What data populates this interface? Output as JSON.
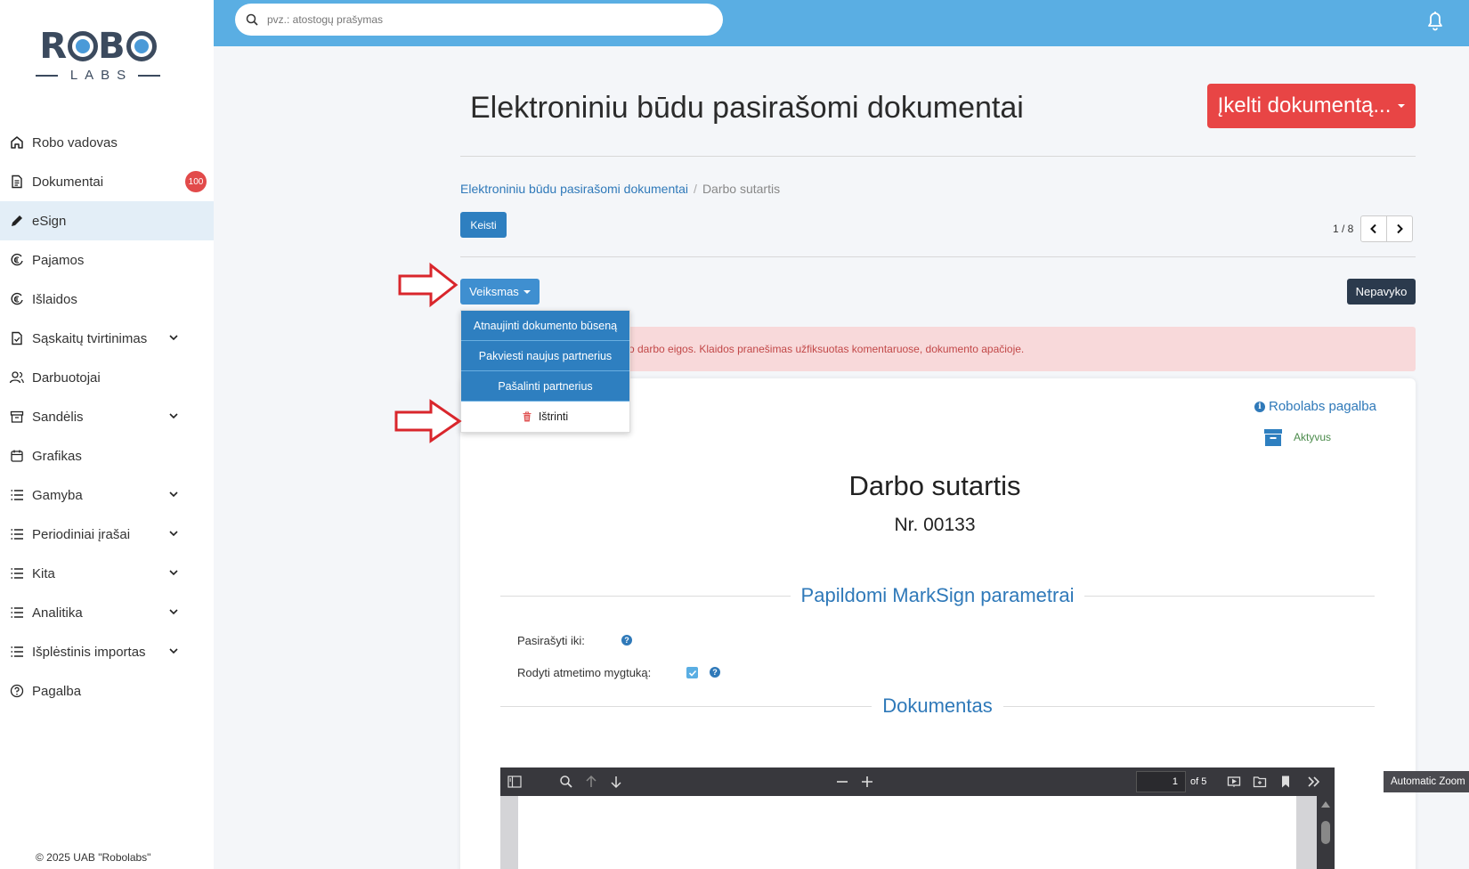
{
  "sidebar": {
    "logo_top": "ROBO",
    "logo_bottom": "LABS",
    "items": [
      {
        "label": "Robo vadovas",
        "icon": "home-icon"
      },
      {
        "label": "Dokumentai",
        "icon": "document-icon",
        "badge": "100"
      },
      {
        "label": "eSign",
        "icon": "pen-icon",
        "active": true
      },
      {
        "label": "Pajamos",
        "icon": "euro-in-icon"
      },
      {
        "label": "Išlaidos",
        "icon": "euro-out-icon"
      },
      {
        "label": "Sąskaitų tvirtinimas",
        "icon": "file-check-icon",
        "expandable": true
      },
      {
        "label": "Darbuotojai",
        "icon": "users-icon"
      },
      {
        "label": "Sandėlis",
        "icon": "archive-icon",
        "expandable": true
      },
      {
        "label": "Grafikas",
        "icon": "calendar-icon"
      },
      {
        "label": "Gamyba",
        "icon": "list-icon",
        "expandable": true
      },
      {
        "label": "Periodiniai įrašai",
        "icon": "list-icon",
        "expandable": true
      },
      {
        "label": "Kita",
        "icon": "list-icon",
        "expandable": true
      },
      {
        "label": "Analitika",
        "icon": "list-icon",
        "expandable": true
      },
      {
        "label": "Išplėstinis importas",
        "icon": "list-icon",
        "expandable": true
      },
      {
        "label": "Pagalba",
        "icon": "help-icon"
      }
    ],
    "copyright": "© 2025 UAB \"Robolabs\""
  },
  "topbar": {
    "search_placeholder": "pvz.: atostogų prašymas"
  },
  "main": {
    "title": "Elektroniniu būdu pasirašomi dokumentai",
    "upload_button": "Įkelti dokumentą...",
    "breadcrumb": {
      "parent": "Elektroniniu būdu pasirašomi dokumentai",
      "separator": "/",
      "current": "Darbo sutartis"
    },
    "edit_button": "Keisti",
    "pager": "1 / 8",
    "action_button": "Veiksmas",
    "status_button": "Nepavyko",
    "alert_text": "o darbo eigos. Klaidos pranešimas užfiksuotas komentaruose, dokumento apačioje.",
    "dropdown": [
      "Atnaujinti dokumento būseną",
      "Pakviesti naujus partnerius",
      "Pašalinti partnerius",
      "Ištrinti"
    ],
    "help_link": "Robolabs pagalba",
    "doc_status": "Aktyvus",
    "doc_title": "Darbo sutartis",
    "doc_number": "Nr. 00133",
    "section_marksign": "Papildomi MarkSign parametrai",
    "field_sign_until": "Pasirašyti iki:",
    "field_show_reject": "Rodyti atmetimo mygtuką:",
    "show_reject_checked": true,
    "section_document": "Dokumentas"
  },
  "pdf_viewer": {
    "page_value": "1",
    "page_of": "of 5",
    "zoom": "Automatic Zoom"
  },
  "colors": {
    "topbar": "#5aaee3",
    "primary": "#2e7fc0",
    "danger": "#e84545",
    "dark": "#2b3a4d",
    "annotation_arrow": "#d9262c"
  }
}
